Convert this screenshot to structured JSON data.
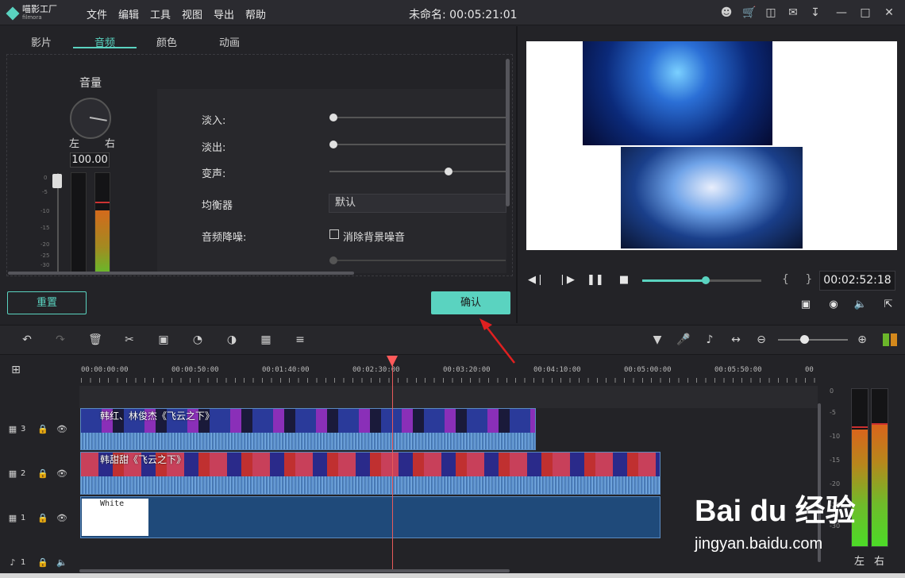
{
  "app": {
    "logo": "喵影工厂",
    "logo_sub": "filmora",
    "menu": [
      "文件",
      "编辑",
      "工具",
      "视图",
      "导出",
      "帮助"
    ],
    "doc_title": "未命名: 00:05:21:01",
    "titlebar_icons": [
      "user-icon",
      "cart-icon",
      "save-icon",
      "mail-icon",
      "download-icon",
      "minimize-icon",
      "maximize-icon",
      "close-icon"
    ]
  },
  "tabs": {
    "video": "影片",
    "audio": "音频",
    "color": "颜色",
    "animation": "动画",
    "active": "音频"
  },
  "volume": {
    "title": "音量",
    "left_label": "左",
    "right_label": "右",
    "value": "100.00",
    "scale": [
      "0",
      "-5",
      "-10",
      "-15",
      "-20",
      "-25",
      "-30"
    ]
  },
  "settings": {
    "fade_in": "淡入:",
    "fade_out": "淡出:",
    "pitch": "变声:",
    "equalizer": "均衡器",
    "equalizer_value": "默认",
    "denoise": "音频降噪:",
    "denoise_option": "消除背景噪音",
    "denoise_checked": false,
    "fade_in_level": 0,
    "fade_out_level": 0,
    "pitch_level": 0.68
  },
  "buttons": {
    "reset": "重置",
    "ok": "确认"
  },
  "preview": {
    "timecode": "00:02:52:18",
    "progress": 0.53,
    "controls": [
      "prev-frame-icon",
      "play-icon",
      "pause-icon",
      "stop-icon"
    ],
    "markers": "{ }",
    "tools": [
      "display-settings-icon",
      "snapshot-icon",
      "volume-icon",
      "fullscreen-icon"
    ]
  },
  "timeline": {
    "toolbar_left": [
      "undo-icon",
      "redo-icon",
      "delete-icon",
      "cut-icon",
      "crop-icon",
      "speed-icon",
      "color-icon",
      "green-screen-icon",
      "audio-mixer-icon"
    ],
    "toolbar_right": [
      "marker-icon",
      "voiceover-icon",
      "audio-icon",
      "fit-icon",
      "zoom-out-icon",
      "zoom-in-icon"
    ],
    "zoom_level": 0.37,
    "ruler": [
      "00:00:00:00",
      "00:00:50:00",
      "00:01:40:00",
      "00:02:30:00",
      "00:03:20:00",
      "00:04:10:00",
      "00:05:00:00",
      "00:05:50:00",
      "00"
    ],
    "tracks": [
      {
        "id": "3",
        "clip_title": "韩红、林俊杰《飞云之下》"
      },
      {
        "id": "2",
        "clip_title": "韩甜甜《飞云之下》"
      },
      {
        "id": "1",
        "clip_title": "White"
      },
      {
        "id": "1",
        "type": "audio"
      }
    ]
  },
  "meter": {
    "scale": [
      "0",
      "-5",
      "-10",
      "-15",
      "-20",
      "-25",
      "-30"
    ],
    "left": "左",
    "right": "右"
  },
  "watermark": {
    "main": "Bai du 经验",
    "sub": "jingyan.baidu.com"
  },
  "colors": {
    "accent": "#5ad3c0",
    "playhead": "#ff5a5a",
    "clip": "#2d5a92"
  }
}
